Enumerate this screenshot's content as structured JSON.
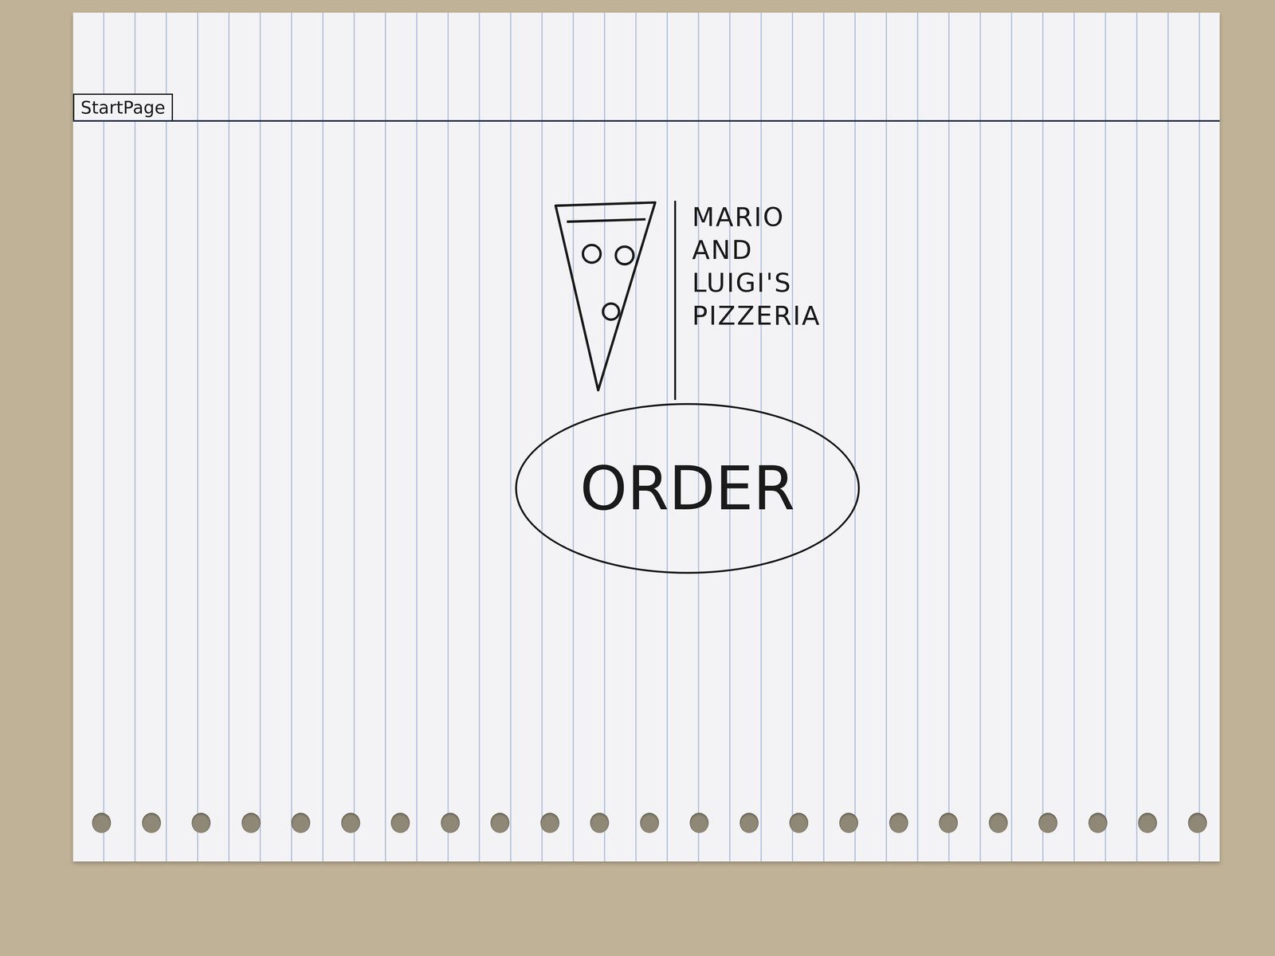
{
  "tab": {
    "label": "StartPage"
  },
  "logo": {
    "lines": [
      "MARIO",
      "AND",
      "LUIGI'S",
      "PIZZERIA"
    ]
  },
  "buttons": [
    "ORDER"
  ]
}
